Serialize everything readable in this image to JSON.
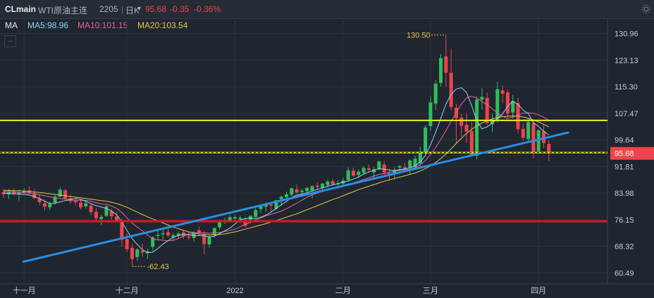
{
  "header": {
    "symbol": "CLmain",
    "name": "WTI原油主连",
    "contract": "2205",
    "separator": "|",
    "period": "日K",
    "period_caret": "▾",
    "price": "95.68",
    "change": "-0.35",
    "change_pct": "-0.36%"
  },
  "indicators": {
    "label": "MA",
    "ma5": "MA5:98.96",
    "ma10": "MA10:101.15",
    "ma20": "MA20:103.54"
  },
  "colors": {
    "background": "#1f2630",
    "up": "#2fbe5a",
    "down": "#f0434b",
    "ma5": "#8fd3f5",
    "ma10": "#e8629a",
    "ma20": "#e6c54a",
    "trendline": "#2a8fe8",
    "yellow_line": "#f0f01e",
    "red_line": "#e0141e",
    "header_price": "#f0434b",
    "annotation": "#e6c54a",
    "price_tag": "#f0434b"
  },
  "chart_data": {
    "type": "candlestick",
    "y_ticks": [
      "130.96",
      "123.13",
      "115.30",
      "107.47",
      "99.64",
      "91.81",
      "83.98",
      "76.15",
      "68.32",
      "60.49"
    ],
    "x_ticks": [
      "十一月",
      "十二月",
      "2022",
      "二月",
      "三月",
      "四月"
    ],
    "ylim": [
      58,
      135
    ],
    "last_price_tag": "95.68",
    "high_annotation": "130.50",
    "low_annotation": "62.43",
    "horizontal_lines": [
      {
        "name": "yellow-resistance",
        "value": 105.4,
        "style": "solid"
      },
      {
        "name": "yellow-dashed-current",
        "value": 95.9,
        "style": "dashed"
      },
      {
        "name": "red-support",
        "value": 75.7,
        "style": "solid"
      }
    ],
    "trendline": {
      "from": {
        "date": "2021-10-18",
        "value": 63.8
      },
      "to": {
        "date": "2022-04-11",
        "value": 101.8
      }
    },
    "candles": [
      [
        84.3,
        85.2,
        82.5,
        83.7
      ],
      [
        83.6,
        85.2,
        82.3,
        84.3
      ],
      [
        84.5,
        85.4,
        83.3,
        83.7
      ],
      [
        83.8,
        85.0,
        81.8,
        84.3
      ],
      [
        84.2,
        85.5,
        83.5,
        84.6
      ],
      [
        84.8,
        86.0,
        83.6,
        83.9
      ],
      [
        84.0,
        85.2,
        82.3,
        82.5
      ],
      [
        82.4,
        83.7,
        80.5,
        81.3
      ],
      [
        81.0,
        82.2,
        78.8,
        80.0
      ],
      [
        79.8,
        81.5,
        79.0,
        80.8
      ],
      [
        81.2,
        83.4,
        80.6,
        82.9
      ],
      [
        83.0,
        85.6,
        82.7,
        85.0
      ],
      [
        84.8,
        85.2,
        82.1,
        82.4
      ],
      [
        82.5,
        83.4,
        80.9,
        81.6
      ],
      [
        81.7,
        82.6,
        80.4,
        81.3
      ],
      [
        81.2,
        82.1,
        79.1,
        79.8
      ],
      [
        80.1,
        81.5,
        79.4,
        81.0
      ],
      [
        80.3,
        80.9,
        77.4,
        78.4
      ],
      [
        78.5,
        79.6,
        75.7,
        76.6
      ],
      [
        76.4,
        77.6,
        74.7,
        77.0
      ],
      [
        77.3,
        80.5,
        76.9,
        80.1
      ],
      [
        78.7,
        79.5,
        76.2,
        77.2
      ],
      [
        77.1,
        78.3,
        75.6,
        76.0
      ],
      [
        75.7,
        76.6,
        68.2,
        70.3
      ],
      [
        70.5,
        72.1,
        66.7,
        67.5
      ],
      [
        67.9,
        69.2,
        62.4,
        64.6
      ],
      [
        65.2,
        67.8,
        64.1,
        67.4
      ],
      [
        67.0,
        69.1,
        65.2,
        66.5
      ],
      [
        66.3,
        67.7,
        64.6,
        66.8
      ],
      [
        68.2,
        71.3,
        67.1,
        71.0
      ],
      [
        71.4,
        72.9,
        70.0,
        71.7
      ],
      [
        71.9,
        73.3,
        70.4,
        72.2
      ],
      [
        72.5,
        73.7,
        71.0,
        71.5
      ],
      [
        70.9,
        72.3,
        69.9,
        71.6
      ],
      [
        71.5,
        72.7,
        70.6,
        72.1
      ],
      [
        72.4,
        73.2,
        70.5,
        71.3
      ],
      [
        71.2,
        72.7,
        70.3,
        70.9
      ],
      [
        70.8,
        72.7,
        69.7,
        72.5
      ],
      [
        73.1,
        74.0,
        71.4,
        72.3
      ],
      [
        71.9,
        73.0,
        66.0,
        69.0
      ],
      [
        68.9,
        71.5,
        68.0,
        71.2
      ],
      [
        71.6,
        73.9,
        70.8,
        73.7
      ],
      [
        73.9,
        76.2,
        73.2,
        75.8
      ],
      [
        75.6,
        76.8,
        75.0,
        75.7
      ],
      [
        75.9,
        77.5,
        75.4,
        76.9
      ],
      [
        76.5,
        77.5,
        75.9,
        76.9
      ],
      [
        76.3,
        77.4,
        75.2,
        76.7
      ],
      [
        76.1,
        77.0,
        73.9,
        74.4
      ],
      [
        76.2,
        77.5,
        75.0,
        77.3
      ],
      [
        77.0,
        79.8,
        76.7,
        79.0
      ],
      [
        79.3,
        80.3,
        78.2,
        80.1
      ],
      [
        80.0,
        81.3,
        78.6,
        80.9
      ],
      [
        80.6,
        81.4,
        78.5,
        80.3
      ],
      [
        79.4,
        82.0,
        78.9,
        81.9
      ],
      [
        82.2,
        83.2,
        80.2,
        82.9
      ],
      [
        82.8,
        84.4,
        82.0,
        83.6
      ],
      [
        83.5,
        85.7,
        83.1,
        85.4
      ],
      [
        85.1,
        86.5,
        83.8,
        84.2
      ],
      [
        84.3,
        85.3,
        83.1,
        84.7
      ],
      [
        84.6,
        85.8,
        84.0,
        85.5
      ],
      [
        84.7,
        86.3,
        82.4,
        86.0
      ],
      [
        86.2,
        87.2,
        84.8,
        85.8
      ],
      [
        85.5,
        86.9,
        84.3,
        86.8
      ],
      [
        86.4,
        87.9,
        85.7,
        87.4
      ],
      [
        87.5,
        88.3,
        86.3,
        86.6
      ],
      [
        86.6,
        87.8,
        85.4,
        86.9
      ],
      [
        86.8,
        88.5,
        85.9,
        87.7
      ],
      [
        87.9,
        91.6,
        87.2,
        90.7
      ],
      [
        90.6,
        91.5,
        88.8,
        89.1
      ],
      [
        89.3,
        91.0,
        88.5,
        90.3
      ],
      [
        90.0,
        91.9,
        89.4,
        91.4
      ],
      [
        91.3,
        92.4,
        90.2,
        90.8
      ],
      [
        90.1,
        91.7,
        88.0,
        91.0
      ],
      [
        91.0,
        93.5,
        90.7,
        93.3
      ],
      [
        92.4,
        93.3,
        89.4,
        90.1
      ],
      [
        89.9,
        91.0,
        87.5,
        89.6
      ],
      [
        89.7,
        91.6,
        88.0,
        90.8
      ],
      [
        91.5,
        92.4,
        90.1,
        91.9
      ],
      [
        91.6,
        92.9,
        90.8,
        91.2
      ],
      [
        91.5,
        93.9,
        89.6,
        93.6
      ],
      [
        91.7,
        95.0,
        90.9,
        94.1
      ],
      [
        92.8,
        97.6,
        91.9,
        96.2
      ],
      [
        96.0,
        104.0,
        95.5,
        103.3
      ],
      [
        103.7,
        112.5,
        102.3,
        110.7
      ],
      [
        110.3,
        117.2,
        108.4,
        116.2
      ],
      [
        116.4,
        124.9,
        115.4,
        123.7
      ],
      [
        124.2,
        130.5,
        115.3,
        119.4
      ],
      [
        119.4,
        126.5,
        108.3,
        109.3
      ],
      [
        109.1,
        110.3,
        98.7,
        106.0
      ],
      [
        106.2,
        107.3,
        100.6,
        103.8
      ],
      [
        104.1,
        107.6,
        98.7,
        102.1
      ],
      [
        102.2,
        104.9,
        95.4,
        95.2
      ],
      [
        95.0,
        112.4,
        93.9,
        111.5
      ],
      [
        111.5,
        114.9,
        108.6,
        112.3
      ],
      [
        112.0,
        113.6,
        104.1,
        104.6
      ],
      [
        104.3,
        107.4,
        101.9,
        105.5
      ],
      [
        105.7,
        116.7,
        104.8,
        114.6
      ],
      [
        114.2,
        115.6,
        110.4,
        113.2
      ],
      [
        113.6,
        114.4,
        106.2,
        107.4
      ],
      [
        107.7,
        112.9,
        105.9,
        111.1
      ],
      [
        110.5,
        112.0,
        101.6,
        102.8
      ],
      [
        102.9,
        104.6,
        99.4,
        100.3
      ],
      [
        99.9,
        105.8,
        99.2,
        104.9
      ],
      [
        104.6,
        105.5,
        94.3,
        96.0
      ],
      [
        96.3,
        102.7,
        95.6,
        102.5
      ],
      [
        102.2,
        104.3,
        97.2,
        98.7
      ],
      [
        98.5,
        99.6,
        93.4,
        95.7
      ]
    ],
    "ma5": [
      84.0,
      83.9,
      83.8,
      83.7,
      83.6,
      83.4,
      83.0,
      82.4,
      81.6,
      80.9,
      81.0,
      81.4,
      81.8,
      82.1,
      82.4,
      82.2,
      81.6,
      80.9,
      80.3,
      79.9,
      79.5,
      78.7,
      77.6,
      75.5,
      73.0,
      70.6,
      68.9,
      67.3,
      66.5,
      66.6,
      67.7,
      69.0,
      70.0,
      71.0,
      71.5,
      71.9,
      71.7,
      71.5,
      71.5,
      71.4,
      71.1,
      71.3,
      72.1,
      72.9,
      73.7,
      74.9,
      76.1,
      76.5,
      76.6,
      76.5,
      76.9,
      77.5,
      78.4,
      79.5,
      80.6,
      81.5,
      82.7,
      83.4,
      83.7,
      84.1,
      84.6,
      85.1,
      85.5,
      86.0,
      86.4,
      86.8,
      87.2,
      87.6,
      88.1,
      88.7,
      89.6,
      90.2,
      90.7,
      91.2,
      91.0,
      90.8,
      90.6,
      90.9,
      91.1,
      91.4,
      92.0,
      93.1,
      95.1,
      98.2,
      101.9,
      106.0,
      110.2,
      113.0,
      114.6,
      115.0,
      113.6,
      109.7,
      105.3,
      102.9,
      103.5,
      104.6,
      105.9,
      107.3,
      109.5,
      111.0,
      110.1,
      108.4,
      107.4,
      104.7,
      103.6,
      102.2,
      101.1
    ],
    "ma10": [
      84.5,
      84.4,
      84.3,
      84.2,
      84.1,
      84.0,
      83.8,
      83.5,
      83.2,
      82.9,
      82.6,
      82.4,
      82.2,
      82.0,
      81.8,
      81.8,
      81.9,
      81.6,
      81.2,
      80.8,
      80.7,
      80.2,
      79.5,
      78.3,
      76.7,
      75.2,
      74.0,
      72.9,
      71.6,
      70.6,
      70.3,
      70.1,
      70.0,
      70.1,
      70.6,
      71.3,
      71.9,
      72.2,
      72.4,
      72.3,
      72.2,
      72.2,
      72.4,
      72.7,
      73.0,
      73.4,
      74.1,
      74.8,
      75.4,
      76.1,
      76.7,
      77.3,
      77.8,
      78.2,
      78.7,
      79.4,
      80.2,
      81.0,
      81.9,
      82.8,
      83.5,
      84.0,
      84.5,
      85.0,
      85.3,
      85.6,
      86.0,
      86.5,
      87.0,
      87.5,
      88.0,
      88.5,
      89.0,
      89.5,
      89.8,
      90.1,
      90.4,
      90.7,
      90.9,
      91.0,
      91.5,
      92.3,
      93.6,
      95.4,
      97.4,
      99.8,
      102.4,
      105.1,
      107.7,
      110.2,
      112.0,
      112.5,
      112.0,
      110.9,
      110.0,
      108.8,
      107.6,
      106.6,
      105.9,
      106.4,
      107.0,
      107.5,
      107.6,
      107.5,
      107.0,
      106.3,
      105.4
    ],
    "ma20": [
      84.8,
      84.8,
      84.7,
      84.7,
      84.6,
      84.5,
      84.3,
      84.2,
      84.0,
      83.8,
      83.6,
      83.4,
      83.2,
      83.0,
      82.8,
      82.6,
      82.4,
      82.2,
      82.0,
      81.8,
      81.6,
      81.3,
      80.9,
      80.4,
      79.8,
      79.1,
      78.4,
      77.7,
      77.0,
      76.4,
      75.8,
      75.2,
      74.6,
      74.0,
      73.5,
      73.0,
      72.6,
      72.3,
      72.0,
      71.8,
      71.7,
      71.7,
      71.8,
      72.0,
      72.3,
      72.6,
      73.0,
      73.4,
      73.8,
      74.2,
      74.6,
      75.0,
      75.5,
      75.9,
      76.4,
      76.9,
      77.4,
      77.9,
      78.5,
      79.1,
      79.7,
      80.3,
      80.9,
      81.5,
      82.1,
      82.6,
      83.2,
      83.8,
      84.4,
      85.0,
      85.5,
      86.0,
      86.5,
      87.0,
      87.5,
      87.9,
      88.3,
      88.7,
      89.1,
      89.5,
      89.9,
      90.5,
      91.2,
      92.0,
      93.0,
      94.2,
      95.5,
      97.0,
      98.6,
      100.1,
      101.6,
      102.8,
      103.8,
      104.6,
      105.3,
      105.8,
      106.2,
      106.5,
      106.6,
      106.7,
      106.6,
      106.4,
      106.0,
      105.5,
      104.9,
      104.2,
      103.5
    ]
  }
}
